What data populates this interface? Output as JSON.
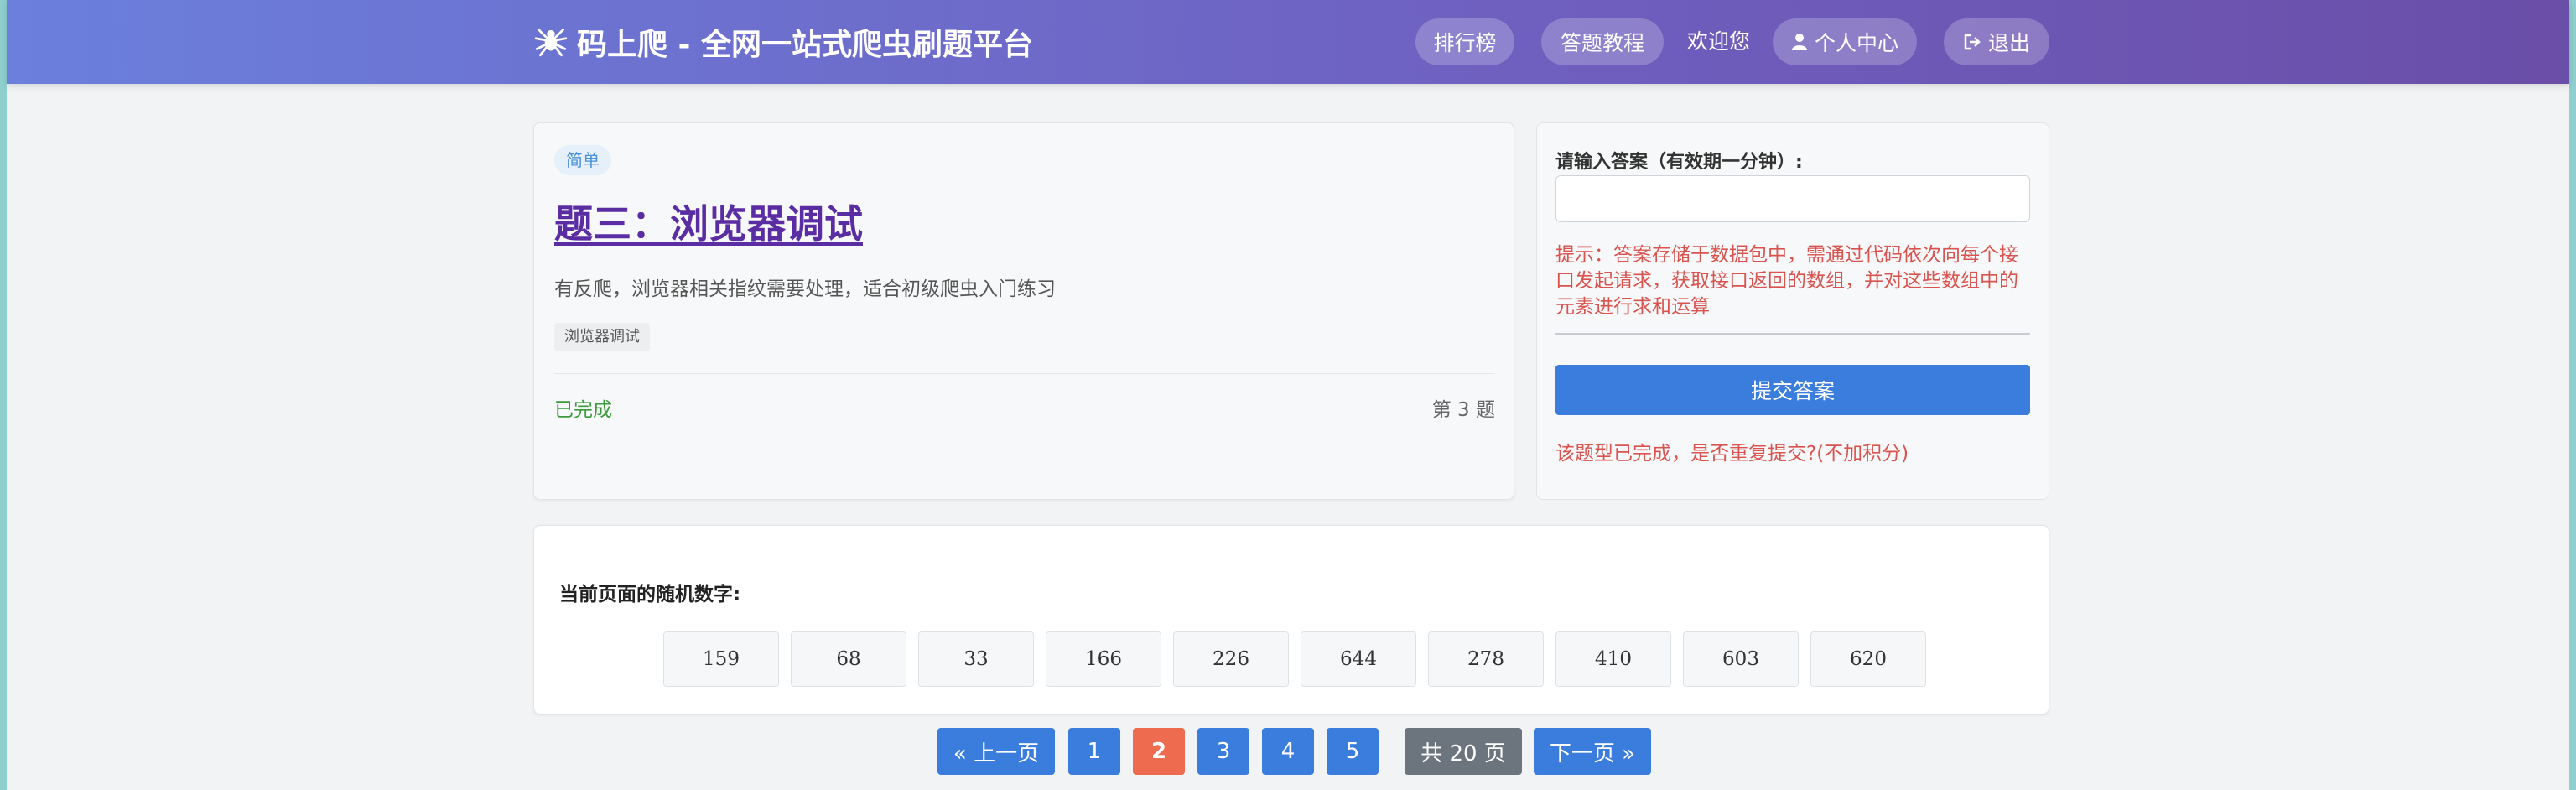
{
  "header": {
    "brand": "码上爬 - 全网一站式爬虫刷题平台",
    "nav": {
      "ranking": "排行榜",
      "tutorial": "答题教程",
      "welcome": "欢迎您",
      "profile": "个人中心",
      "logout": "退出"
    }
  },
  "question": {
    "difficulty": "简单",
    "title": "题三：浏览器调试",
    "description": "有反爬，浏览器相关指纹需要处理，适合初级爬虫入门练习",
    "tag": "浏览器调试",
    "status": "已完成",
    "number": "第 3 题"
  },
  "answer": {
    "label": "请输入答案（有效期一分钟）:",
    "value": "",
    "hint": "提示：答案存储于数据包中，需通过代码依次向每个接口发起请求，获取接口返回的数组，并对这些数组中的元素进行求和运算",
    "submit": "提交答案",
    "warning": "该题型已完成，是否重复提交?(不加积分)"
  },
  "random": {
    "label": "当前页面的随机数字:",
    "numbers": [
      "159",
      "68",
      "33",
      "166",
      "226",
      "644",
      "278",
      "410",
      "603",
      "620"
    ]
  },
  "pagination": {
    "prev": "« 上一页",
    "pages": [
      "1",
      "2",
      "3",
      "4",
      "5"
    ],
    "current": "2",
    "total": "共 20 页",
    "next": "下一页 »"
  },
  "colors": {
    "header_gradient": [
      "#6b7fdc",
      "#6a4ea8"
    ],
    "primary": "#3b7ddd",
    "active_page": "#ef6b4f",
    "hint_red": "#d9534f",
    "done_green": "#3c9a3c"
  }
}
